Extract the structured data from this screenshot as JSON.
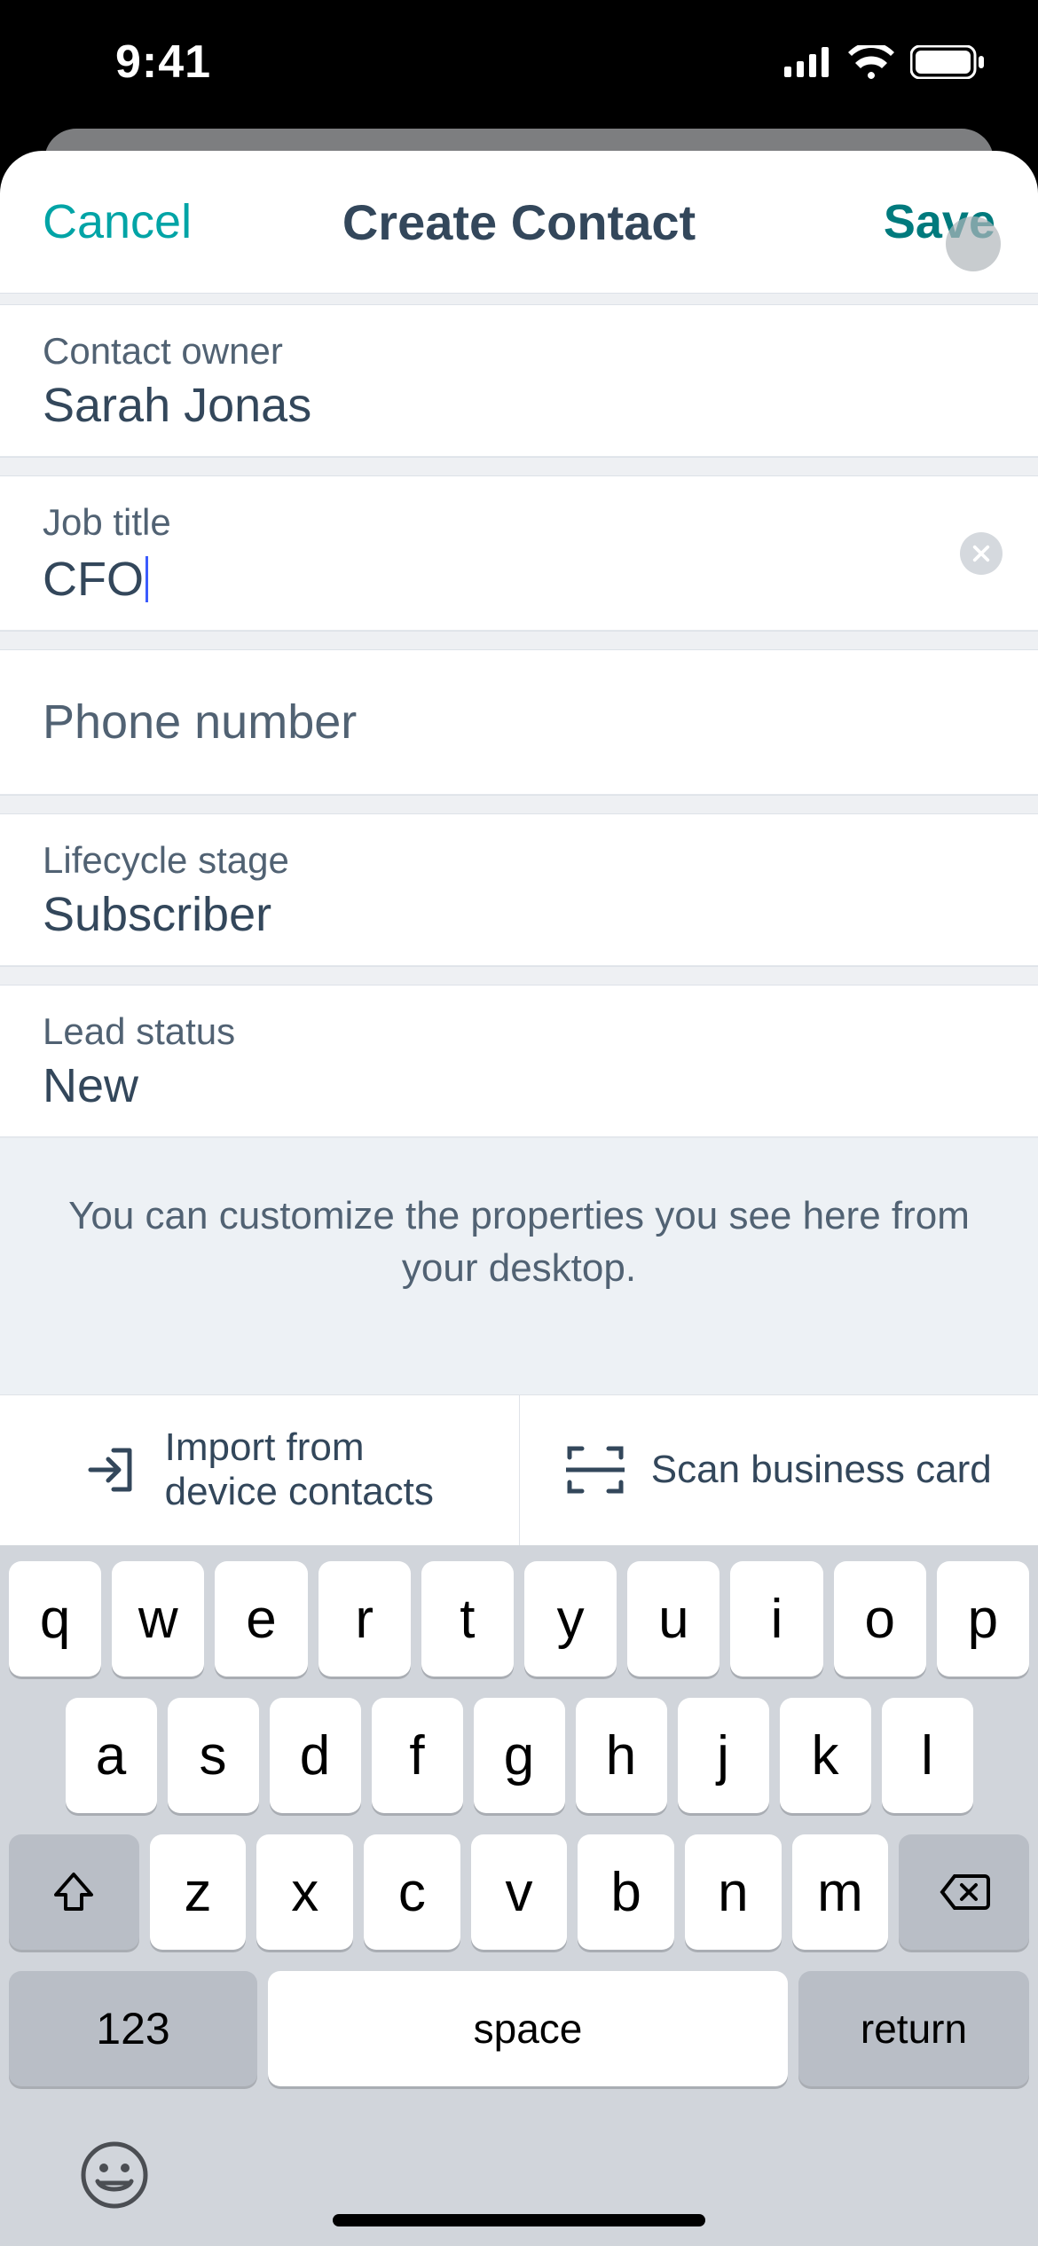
{
  "status": {
    "time": "9:41"
  },
  "nav": {
    "cancel": "Cancel",
    "title": "Create Contact",
    "save": "Save"
  },
  "fields": {
    "owner": {
      "label": "Contact owner",
      "value": "Sarah Jonas"
    },
    "job": {
      "label": "Job title",
      "value": "CFO"
    },
    "phone": {
      "placeholder": "Phone number"
    },
    "stage": {
      "label": "Lifecycle stage",
      "value": "Subscriber"
    },
    "lead": {
      "label": "Lead status",
      "value": "New"
    }
  },
  "info": "You can customize the properties you see here from your desktop.",
  "actions": {
    "import": "Import from\ndevice contacts",
    "scan": "Scan business card"
  },
  "keyboard": {
    "row1": [
      "q",
      "w",
      "e",
      "r",
      "t",
      "y",
      "u",
      "i",
      "o",
      "p"
    ],
    "row2": [
      "a",
      "s",
      "d",
      "f",
      "g",
      "h",
      "j",
      "k",
      "l"
    ],
    "row3": [
      "z",
      "x",
      "c",
      "v",
      "b",
      "n",
      "m"
    ],
    "k123": "123",
    "space": "space",
    "return": "return"
  }
}
